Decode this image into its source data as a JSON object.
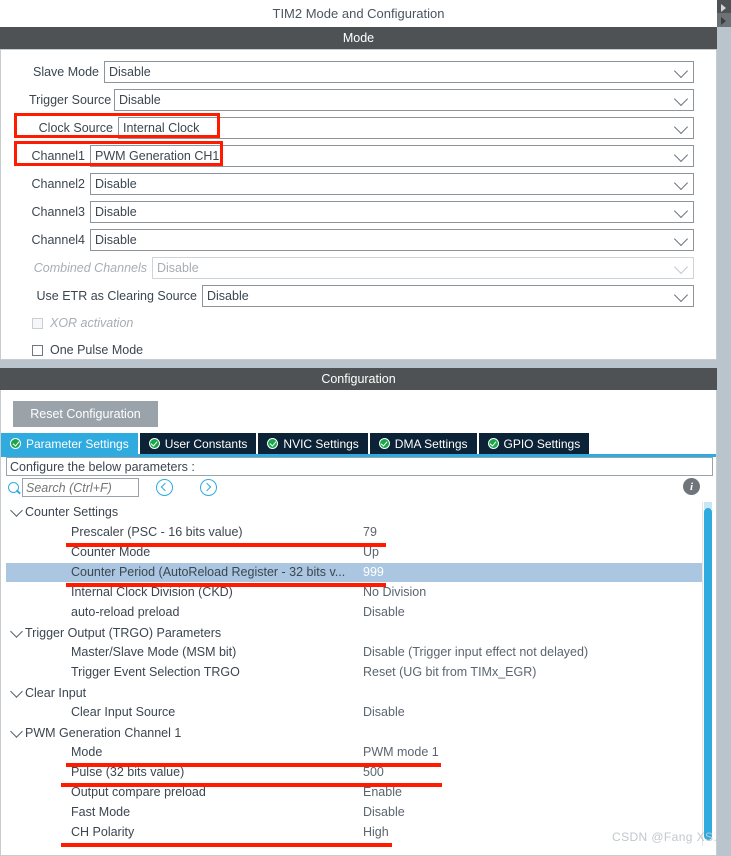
{
  "window": {
    "title": "TIM2 Mode and Configuration"
  },
  "mode": {
    "header": "Mode",
    "rows": [
      {
        "label": "Slave Mode",
        "value": "Disable",
        "disabled": false
      },
      {
        "label": "Trigger Source",
        "value": "Disable",
        "disabled": false
      },
      {
        "label": "Clock Source",
        "value": "Internal Clock",
        "disabled": false
      },
      {
        "label": "Channel1",
        "value": "PWM Generation CH1",
        "disabled": false
      },
      {
        "label": "Channel2",
        "value": "Disable",
        "disabled": false
      },
      {
        "label": "Channel3",
        "value": "Disable",
        "disabled": false
      },
      {
        "label": "Channel4",
        "value": "Disable",
        "disabled": false
      },
      {
        "label": "Combined Channels",
        "value": "Disable",
        "disabled": true
      },
      {
        "label": "Use ETR as Clearing Source",
        "value": "Disable",
        "disabled": false
      }
    ],
    "checkboxes": [
      {
        "label": "XOR activation",
        "checked": false,
        "disabled": true
      },
      {
        "label": "One Pulse Mode",
        "checked": false,
        "disabled": false
      }
    ]
  },
  "configuration": {
    "header": "Configuration",
    "reset_label": "Reset Configuration",
    "tabs": [
      {
        "label": "Parameter Settings",
        "active": true
      },
      {
        "label": "User Constants",
        "active": false
      },
      {
        "label": "NVIC Settings",
        "active": false
      },
      {
        "label": "DMA Settings",
        "active": false
      },
      {
        "label": "GPIO Settings",
        "active": false
      }
    ],
    "note": "Configure the below parameters :",
    "search": {
      "placeholder": "Search (Ctrl+F)",
      "value": ""
    },
    "icons": {
      "search": "search-icon",
      "prev": "chevron-left-circle-icon",
      "next": "chevron-right-circle-icon",
      "info": "info-icon"
    },
    "groups": [
      {
        "name": "Counter Settings",
        "params": [
          {
            "name": "Prescaler (PSC - 16 bits value)",
            "value": "79",
            "selected": false
          },
          {
            "name": "Counter Mode",
            "value": "Up",
            "selected": false
          },
          {
            "name": "Counter Period (AutoReload Register - 32 bits v...",
            "value": "999",
            "selected": true
          },
          {
            "name": "Internal Clock Division (CKD)",
            "value": "No Division",
            "selected": false
          },
          {
            "name": "auto-reload preload",
            "value": "Disable",
            "selected": false
          }
        ]
      },
      {
        "name": "Trigger Output (TRGO) Parameters",
        "params": [
          {
            "name": "Master/Slave Mode (MSM bit)",
            "value": "Disable (Trigger input effect not delayed)",
            "selected": false
          },
          {
            "name": "Trigger Event Selection TRGO",
            "value": "Reset (UG bit from TIMx_EGR)",
            "selected": false
          }
        ]
      },
      {
        "name": "Clear Input",
        "params": [
          {
            "name": "Clear Input Source",
            "value": "Disable",
            "selected": false
          }
        ]
      },
      {
        "name": "PWM Generation Channel 1",
        "params": [
          {
            "name": "Mode",
            "value": "PWM mode 1",
            "selected": false
          },
          {
            "name": "Pulse (32 bits value)",
            "value": "500",
            "selected": false
          },
          {
            "name": "Output compare preload",
            "value": "Enable",
            "selected": false
          },
          {
            "name": "Fast Mode",
            "value": "Disable",
            "selected": false
          },
          {
            "name": "CH Polarity",
            "value": "High",
            "selected": false
          }
        ]
      }
    ]
  },
  "watermark": "CSDN @Fang XS.",
  "colors": {
    "panel_header": "#4f5254",
    "accent": "#2fabe0",
    "tab_inactive": "#0c2236",
    "highlight_red": "#ff1a00",
    "selected_row": "#aac6e0",
    "check_green": "#18a64a"
  }
}
